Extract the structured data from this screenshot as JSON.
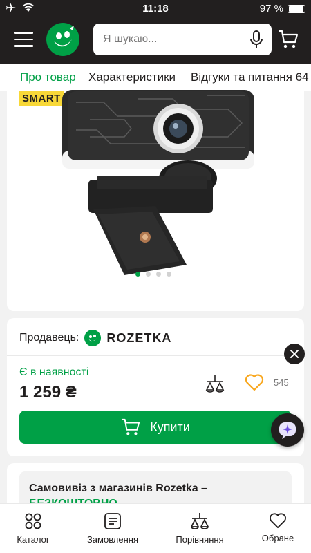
{
  "status_bar": {
    "time": "11:18",
    "battery": "97 %"
  },
  "header": {
    "search_placeholder": "Я шукаю..."
  },
  "tabs": [
    {
      "label": "Про товар",
      "active": true
    },
    {
      "label": "Характеристики",
      "active": false
    },
    {
      "label": "Відгуки та питання",
      "active": false
    },
    {
      "label": "64",
      "active": false
    }
  ],
  "product": {
    "badge": "SMART",
    "gallery": {
      "slides": 4,
      "active_index": 0
    }
  },
  "seller": {
    "label": "Продавець:",
    "name": "ROZETKA"
  },
  "offer": {
    "availability": "Є в наявності",
    "price": "1 259 ₴",
    "favorites_count": "545",
    "buy_label": "Купити"
  },
  "pickup": {
    "title": "Самовивіз з магазинів Rozetka –",
    "free": "БЕЗКОШТОВНО"
  },
  "bottom_nav": [
    {
      "label": "Каталог",
      "icon": "catalog-icon"
    },
    {
      "label": "Замовлення",
      "icon": "orders-icon"
    },
    {
      "label": "Порівняння",
      "icon": "compare-icon"
    },
    {
      "label": "Обране",
      "icon": "heart-icon"
    }
  ],
  "colors": {
    "brand_green": "#00a046",
    "header_dark": "#221f1f",
    "badge_yellow": "#f8d838",
    "favorite_orange": "#f8a61c"
  }
}
